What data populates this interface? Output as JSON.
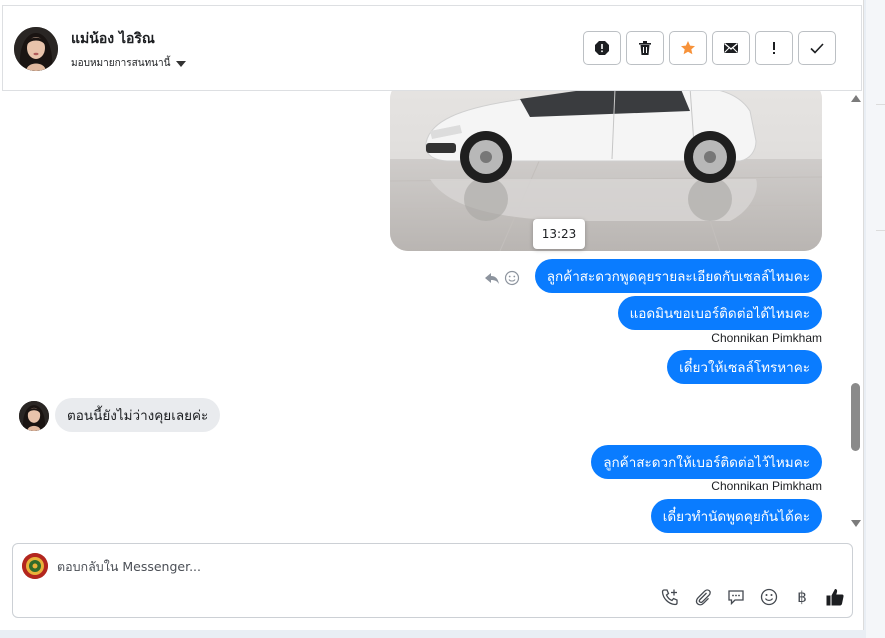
{
  "contact": {
    "name": "แม่น้อง ไอริณ",
    "assign_label": "มอบหมายการสนทนานี้"
  },
  "header_actions": [
    {
      "name": "spam-icon"
    },
    {
      "name": "trash-icon"
    },
    {
      "name": "star-icon",
      "color": "#f7923a"
    },
    {
      "name": "mail-icon"
    },
    {
      "name": "alert-icon"
    },
    {
      "name": "check-icon"
    }
  ],
  "conversation": {
    "photo_time": "13:23",
    "messages": [
      {
        "dir": "out",
        "text": "ลูกค้าสะดวกพูดคุยรายละเอียดกับเซลล์ไหมคะ"
      },
      {
        "dir": "out",
        "text": "แอดมินขอเบอร์ติดต่อได้ไหมคะ"
      },
      {
        "dir": "out",
        "sender": "Chonnikan Pimkham",
        "text": "เดี๋ยวให้เซลล์โทรหาคะ"
      },
      {
        "dir": "in",
        "text": "ตอนนี้ยังไม่ว่างคุยเลยค่ะ"
      },
      {
        "dir": "out",
        "text": "ลูกค้าสะดวกให้เบอร์ติดต่อไว้ไหมคะ"
      },
      {
        "dir": "out",
        "sender": "Chonnikan Pimkham",
        "text": "เดี๋ยวทำนัดพูดคุยกันได้คะ"
      }
    ]
  },
  "composer": {
    "placeholder": "ตอบกลับใน Messenger...",
    "currency_symbol": "฿",
    "tools": [
      "phone-plus-icon",
      "paperclip-icon",
      "speech-bubble-icon",
      "emoji-icon",
      "baht-icon",
      "thumbs-up-icon"
    ]
  },
  "colors": {
    "bubble_out": "#0a7cff",
    "bubble_in": "#e9ebee"
  }
}
